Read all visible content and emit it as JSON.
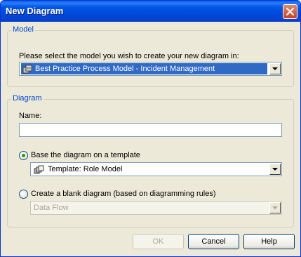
{
  "window": {
    "title": "New Diagram",
    "close_icon": "close-icon"
  },
  "model_group": {
    "title": "Model",
    "prompt": "Please select the model you wish to create your new diagram in:",
    "selected_model": "Best Practice Process Model - Incident Management",
    "model_icon": "model-icon"
  },
  "diagram_group": {
    "title": "Diagram",
    "name_label": "Name:",
    "name_value": "",
    "template_option": {
      "label": "Base the diagram on a template",
      "selected": true,
      "value": "Template: Role Model",
      "icon": "template-icon"
    },
    "blank_option": {
      "label": "Create a blank diagram (based on diagramming rules)",
      "selected": false,
      "value": "Data Flow"
    }
  },
  "buttons": {
    "ok": "OK",
    "cancel": "Cancel",
    "help": "Help"
  },
  "colors": {
    "group_title": "#0046d5",
    "selection": "#316ac5",
    "titlebar": "#0055e5"
  }
}
